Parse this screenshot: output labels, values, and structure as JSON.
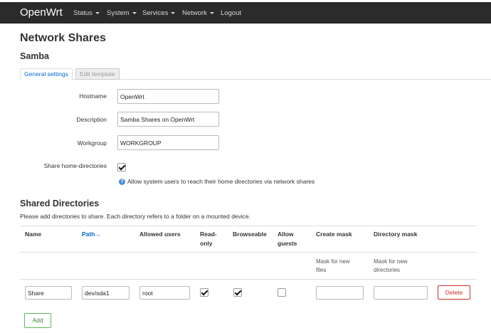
{
  "navbar": {
    "brand": "OpenWrt",
    "items": [
      {
        "label": "Status",
        "dropdown": true
      },
      {
        "label": "System",
        "dropdown": true
      },
      {
        "label": "Services",
        "dropdown": true
      },
      {
        "label": "Network",
        "dropdown": true
      },
      {
        "label": "Logout",
        "dropdown": false
      }
    ]
  },
  "page": {
    "title": "Network Shares",
    "section": "Samba"
  },
  "tabs": [
    {
      "label": "General settings",
      "active": true
    },
    {
      "label": "Edit template",
      "active": false
    }
  ],
  "general": {
    "hostname": {
      "label": "Hostname",
      "value": "OpenWrt"
    },
    "description": {
      "label": "Description",
      "value": "Samba Shares on OpenWrt"
    },
    "workgroup": {
      "label": "Workgroup",
      "value": "WORKGROUP"
    },
    "share_home": {
      "label": "Share home-directories",
      "checked": true,
      "help": "Allow system users to reach their home directories via network shares"
    }
  },
  "shared": {
    "title": "Shared Directories",
    "description": "Please add directories to share. Each directory refers to a folder on a mounted device.",
    "columns": {
      "name": "Name",
      "path": "Path→",
      "allowed_users": "Allowed users",
      "read_only_1": "Read-",
      "read_only_2": "only",
      "browseable": "Browseable",
      "allow_guests_1": "Allow",
      "allow_guests_2": "guests",
      "create_mask": "Create mask",
      "directory_mask": "Directory mask"
    },
    "column_desc": {
      "create_mask_1": "Mask for new",
      "create_mask_2": "files",
      "directory_mask_1": "Mask for new",
      "directory_mask_2": "directories"
    },
    "rows": [
      {
        "name": "Share",
        "path": "dev/sda1",
        "allowed_users": "root",
        "read_only": true,
        "browseable": true,
        "allow_guests": false,
        "create_mask": "",
        "directory_mask": ""
      }
    ],
    "delete_label": "Delete",
    "add_label": "Add"
  },
  "colors": {
    "navbar_bg": "#2b2b2b",
    "link": "#0069d6",
    "delete": "#c9302c",
    "add": "#5cb85c"
  }
}
